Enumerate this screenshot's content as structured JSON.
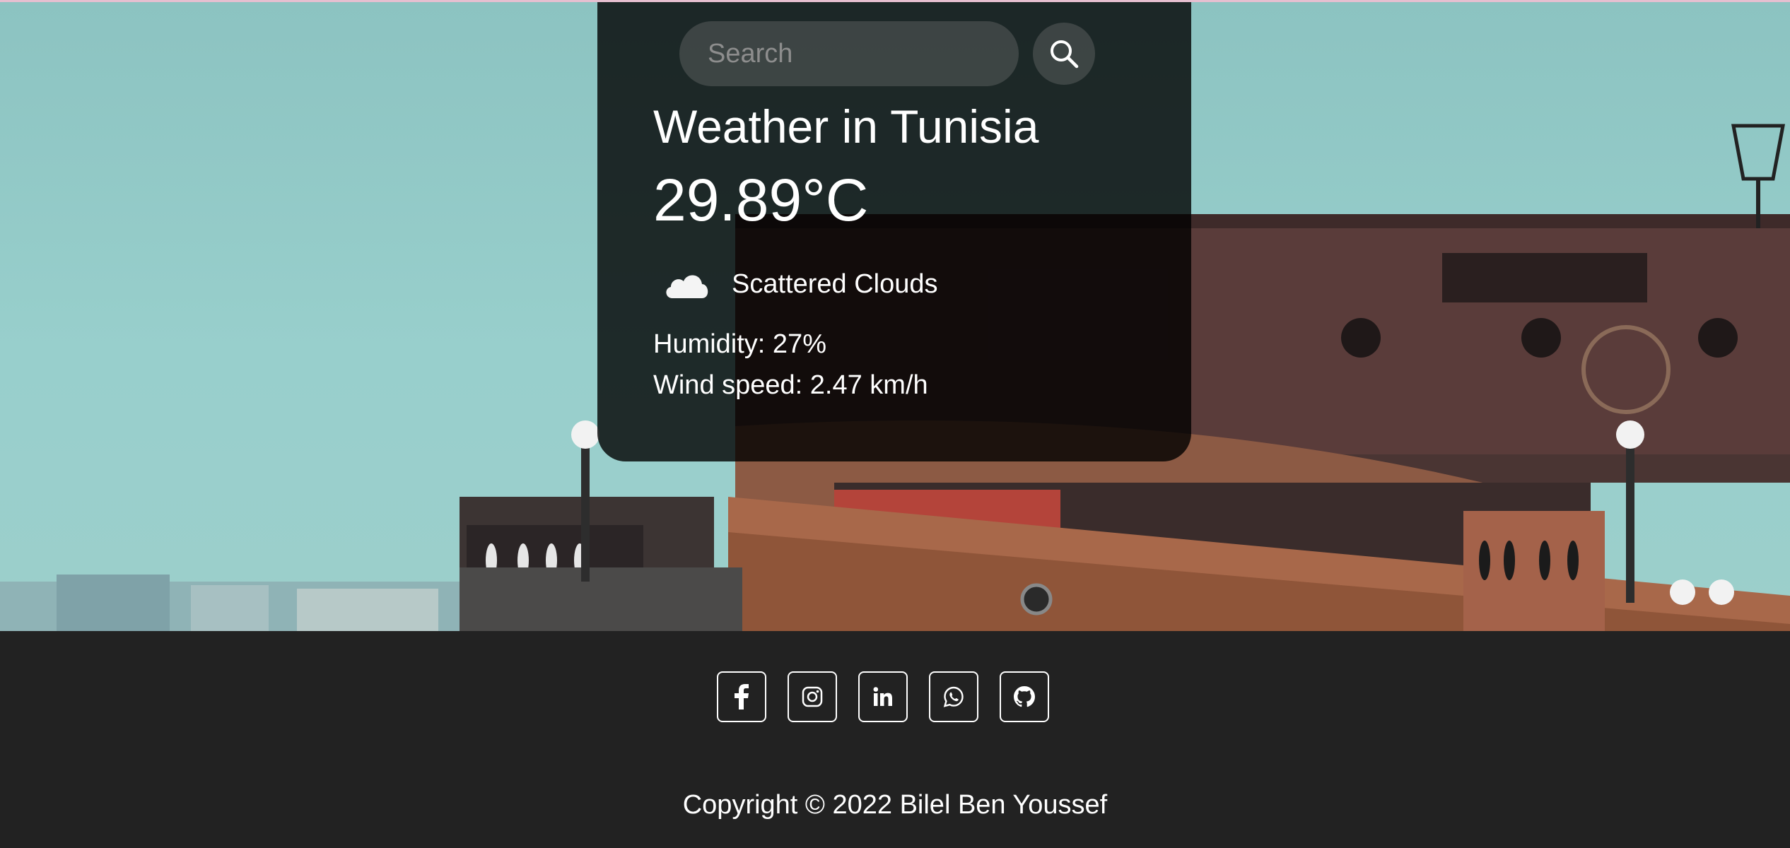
{
  "search": {
    "placeholder": "Search",
    "button_icon": "search-icon"
  },
  "weather": {
    "title": "Weather in Tunisia",
    "temperature": "29.89°C",
    "icon": "cloud-icon",
    "description": "Scattered Clouds",
    "humidity": "Humidity: 27%",
    "wind_speed": "Wind speed: 2.47 km/h"
  },
  "footer": {
    "social_links": [
      {
        "icon": "facebook-icon"
      },
      {
        "icon": "instagram-icon"
      },
      {
        "icon": "linkedin-icon"
      },
      {
        "icon": "whatsapp-icon"
      },
      {
        "icon": "github-icon"
      }
    ],
    "copyright": "Copyright © 2022 Bilel Ben Youssef"
  },
  "colors": {
    "card_bg": "#000000cc",
    "footer_bg": "#222222",
    "text": "#ffffff",
    "sky": "#98cfcc"
  }
}
